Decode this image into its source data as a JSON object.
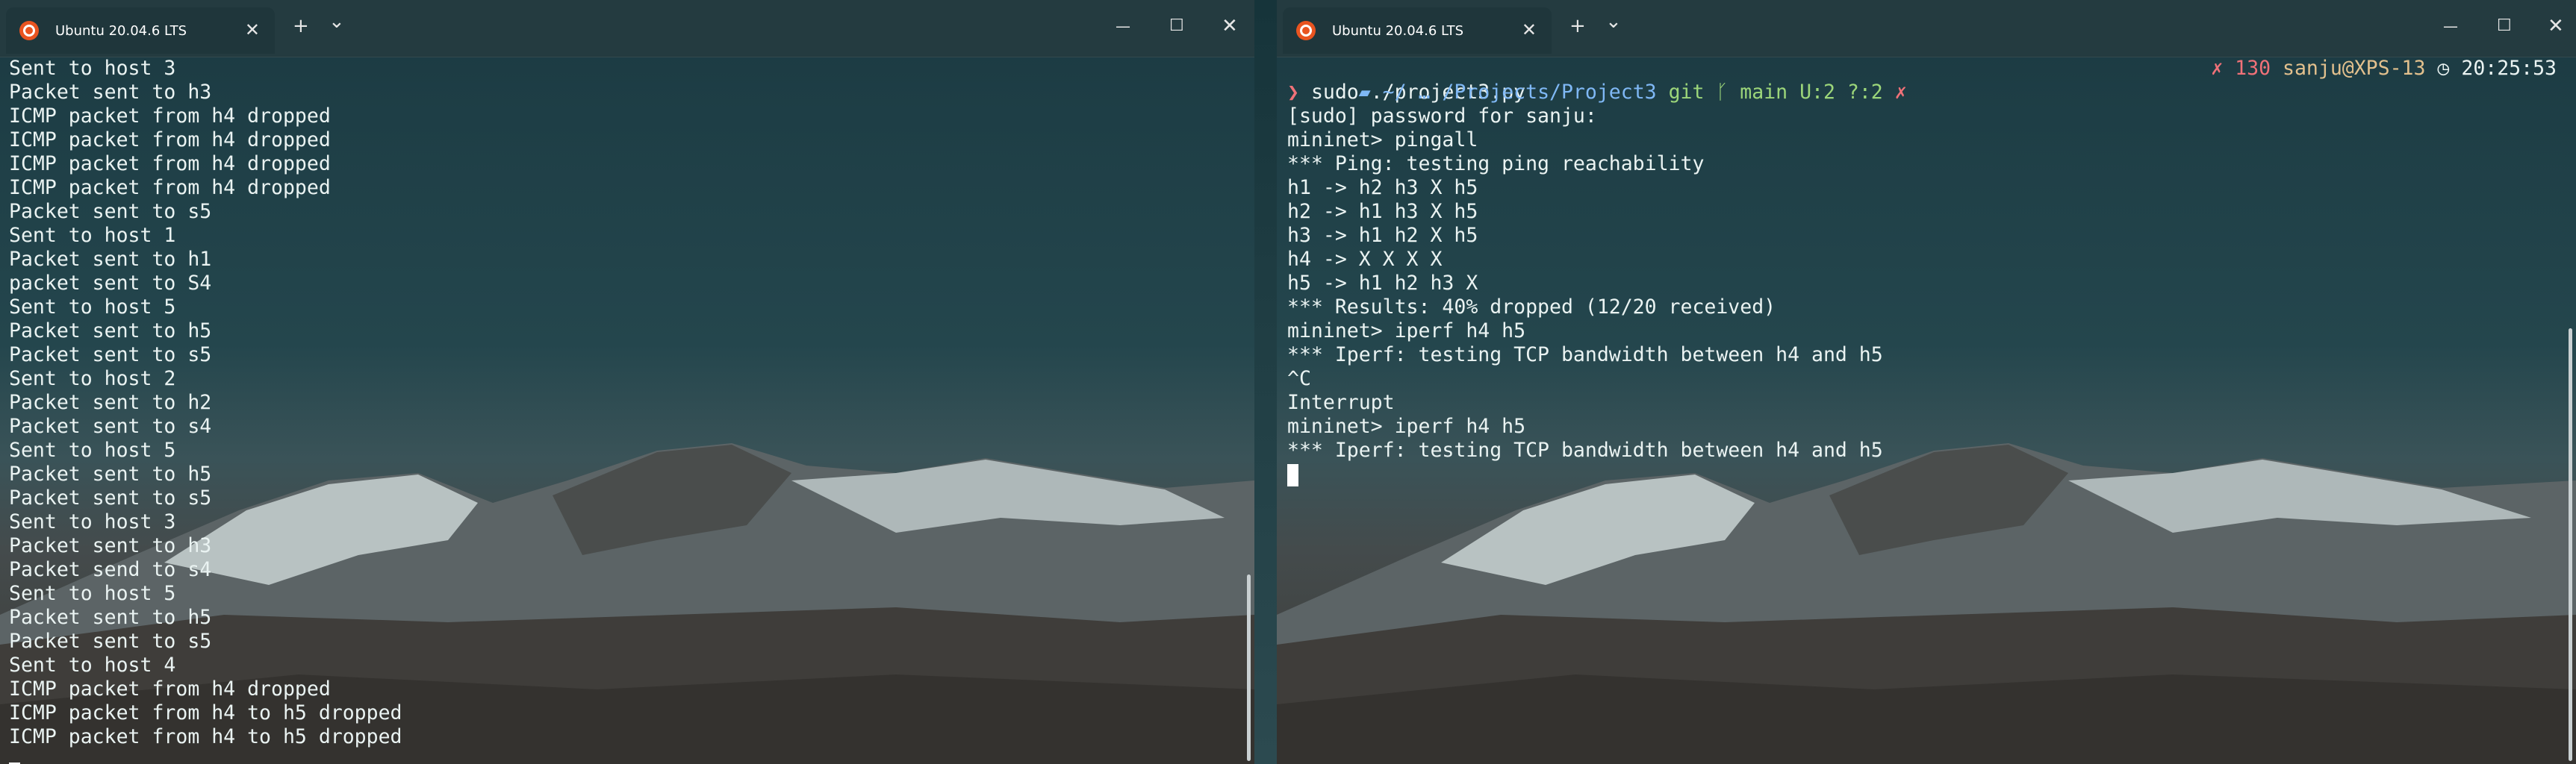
{
  "left_window": {
    "tab_title": "Ubuntu 20.04.6 LTS",
    "lines": [
      "Sent to host 3",
      "Packet sent to h3",
      "ICMP packet from h4 dropped",
      "ICMP packet from h4 dropped",
      "ICMP packet from h4 dropped",
      "ICMP packet from h4 dropped",
      "Packet sent to s5",
      "Sent to host 1",
      "Packet sent to h1",
      "packet sent to S4",
      "Sent to host 5",
      "Packet sent to h5",
      "Packet sent to s5",
      "Sent to host 2",
      "Packet sent to h2",
      "Packet sent to s4",
      "Sent to host 5",
      "Packet sent to h5",
      "Packet sent to s5",
      "Sent to host 3",
      "Packet sent to h3",
      "Packet send to s4",
      "Sent to host 5",
      "Packet sent to h5",
      "Packet sent to s5",
      "Sent to host 4",
      "ICMP packet from h4 dropped",
      "ICMP packet from h4 to h5 dropped",
      "ICMP packet from h4 to h5 dropped"
    ]
  },
  "right_window": {
    "tab_title": "Ubuntu 20.04.6 LTS",
    "prompt": {
      "folder_icon": "folder-icon",
      "path": "~/ … /Projects/Project3",
      "git_label": "git",
      "branch_icon": "git-branch-icon",
      "branch": "main U:2 ?:2",
      "status_mark": "✗",
      "exit_status": "✗ 130",
      "user_host": "sanju@XPS-13",
      "clock_icon": "clock-icon",
      "time": "20:25:53"
    },
    "command_marker": "❯",
    "command": "sudo ./project3.py",
    "lines": [
      "[sudo] password for sanju:",
      "mininet> pingall",
      "*** Ping: testing ping reachability",
      "h1 -> h2 h3 X h5",
      "h2 -> h1 h3 X h5",
      "h3 -> h1 h2 X h5",
      "h4 -> X X X X",
      "h5 -> h1 h2 h3 X",
      "*** Results: 40% dropped (12/20 received)",
      "mininet> iperf h4 h5",
      "*** Iperf: testing TCP bandwidth between h4 and h5",
      "^C",
      "Interrupt",
      "mininet> iperf h4 h5",
      "*** Iperf: testing TCP bandwidth between h4 and h5"
    ]
  },
  "titlebar_controls": {
    "new_tab": "+",
    "dropdown": "⌄",
    "minimize": "—",
    "maximize": "☐",
    "close": "✕",
    "tab_close": "✕"
  },
  "colors": {
    "terminal_text": "#eaf3f2",
    "ubuntu_orange": "#e95420",
    "path_blue": "#7fb8f5",
    "git_green": "#9cd67a",
    "error_red": "#f07178",
    "user_yellow": "#e2c08d"
  }
}
